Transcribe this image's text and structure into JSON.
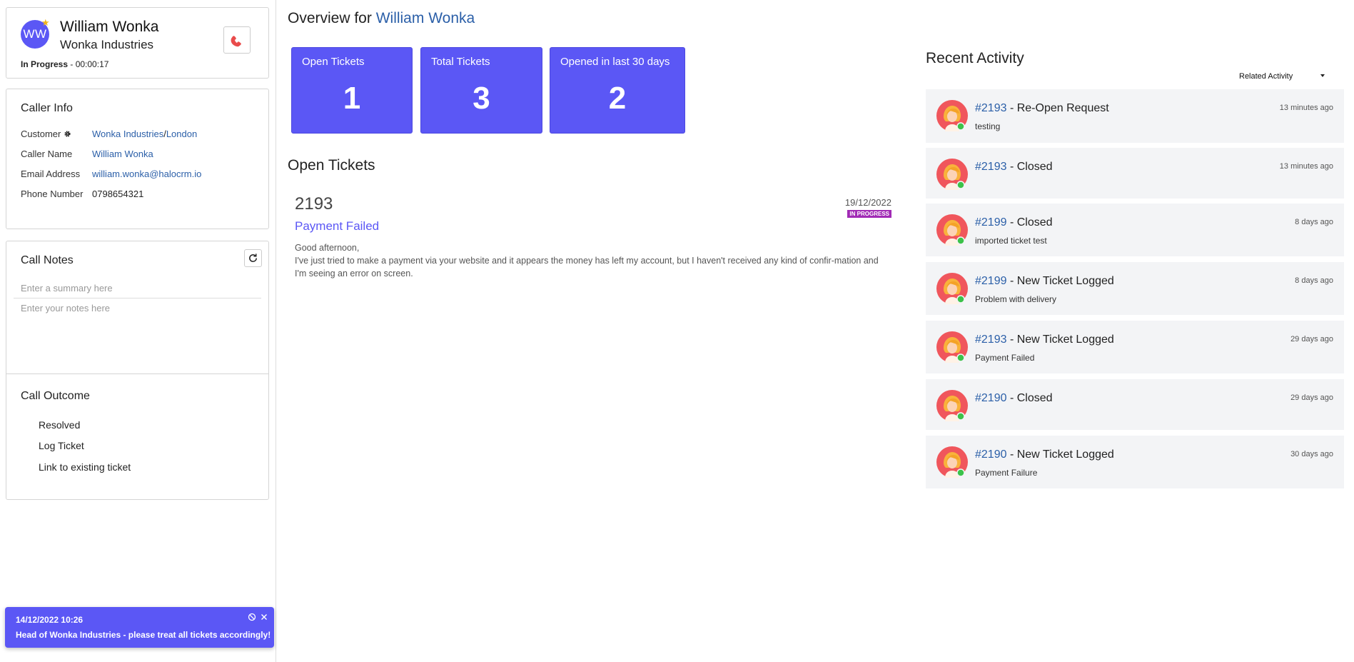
{
  "caller": {
    "initials": "WW",
    "name": "William Wonka",
    "company": "Wonka Industries",
    "status": "In Progress",
    "status_sep": " - ",
    "timer": "00:00:17"
  },
  "caller_info": {
    "title": "Caller Info",
    "rows": [
      {
        "label": "Customer",
        "value": "Wonka Industries",
        "value2": "London"
      },
      {
        "label": "Caller Name",
        "value": "William Wonka"
      },
      {
        "label": "Email Address",
        "value": "william.wonka@halocrm.io"
      },
      {
        "label": "Phone Number",
        "value": "0798654321"
      }
    ],
    "site_sep": "/"
  },
  "call_notes": {
    "title": "Call Notes",
    "summary_placeholder": "Enter a summary here",
    "notes_placeholder": "Enter your notes here"
  },
  "call_outcome": {
    "title": "Call Outcome",
    "options": [
      "Resolved",
      "Log Ticket",
      "Link to existing ticket"
    ]
  },
  "toast": {
    "date": "14/12/2022 10:26",
    "message": "Head of Wonka Industries - please treat all tickets accordingly!"
  },
  "overview": {
    "prefix": "Overview for",
    "name": "William Wonka"
  },
  "stats": [
    {
      "label": "Open Tickets",
      "value": "1"
    },
    {
      "label": "Total Tickets",
      "value": "3"
    },
    {
      "label": "Opened in last 30 days",
      "value": "2"
    }
  ],
  "open_tickets": {
    "title": "Open Tickets",
    "items": [
      {
        "id": "2193",
        "date": "19/12/2022",
        "status": "IN PROGRESS",
        "subject": "Payment Failed",
        "greeting": "Good afternoon,",
        "body": "I've just tried to make a payment via your website and it appears the money has left my account, but I haven't received any kind of confir-mation and I'm seeing an error on screen."
      }
    ]
  },
  "recent_activity": {
    "title": "Recent Activity",
    "filter": "Related Activity",
    "items": [
      {
        "ticket": "#2193",
        "action": " - Re-Open Request",
        "time": "13 minutes ago",
        "note": "testing"
      },
      {
        "ticket": "#2193",
        "action": " - Closed",
        "time": "13 minutes ago",
        "note": ""
      },
      {
        "ticket": "#2199",
        "action": " - Closed",
        "time": "8 days ago",
        "note": "imported ticket test"
      },
      {
        "ticket": "#2199",
        "action": " - New Ticket Logged",
        "time": "8 days ago",
        "note": "Problem with delivery"
      },
      {
        "ticket": "#2193",
        "action": " - New Ticket Logged",
        "time": "29 days ago",
        "note": "Payment Failed"
      },
      {
        "ticket": "#2190",
        "action": " - Closed",
        "time": "29 days ago",
        "note": ""
      },
      {
        "ticket": "#2190",
        "action": " - New Ticket Logged",
        "time": "30 days ago",
        "note": "Payment Failure"
      }
    ]
  },
  "colors": {
    "accent": "#5b57f5",
    "link": "#2b5fa8",
    "badge": "#a12bb5",
    "hangup": "#e94b4b",
    "online": "#3cc24a"
  }
}
